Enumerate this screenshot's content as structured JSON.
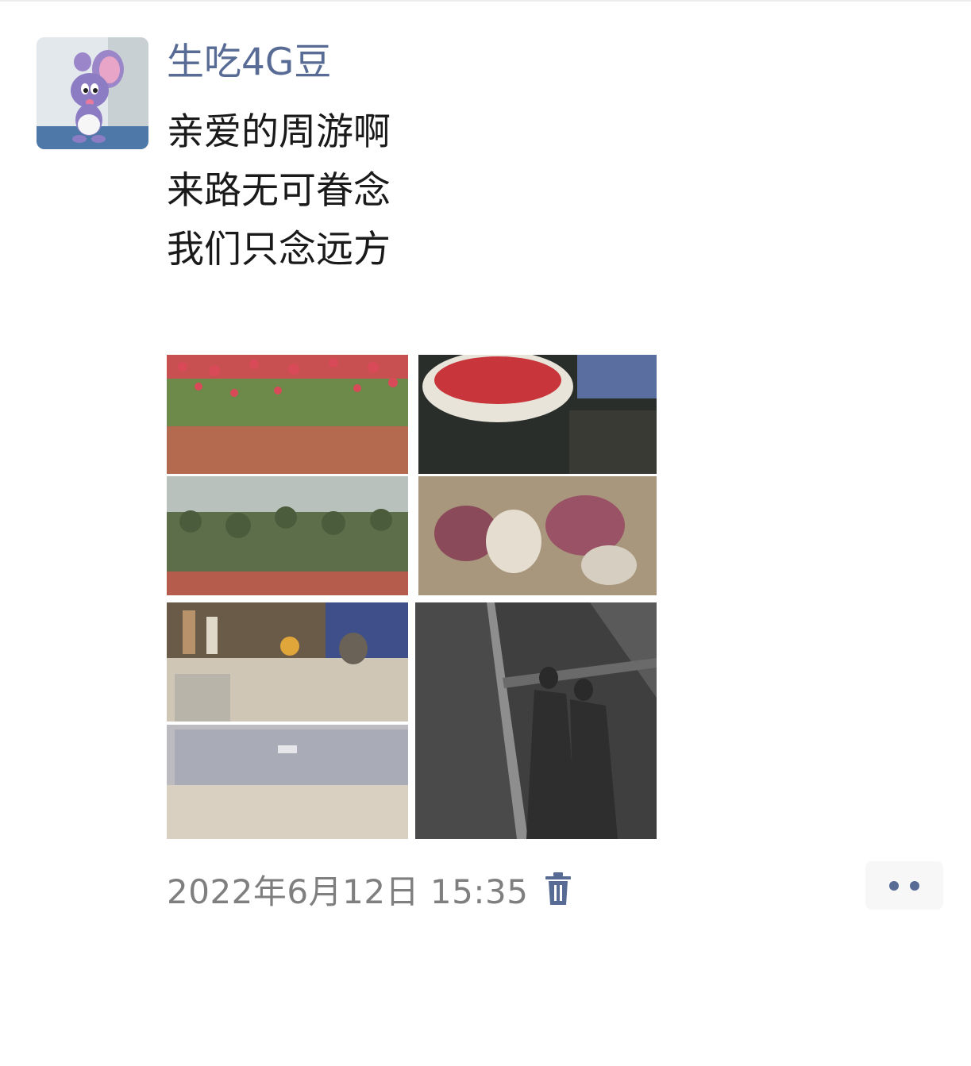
{
  "post": {
    "author_name": "生吃4G豆",
    "text_lines": [
      "亲爱的周游啊",
      "来路无可眷念",
      "我们只念远方"
    ],
    "timestamp": "2022年6月12日 15:35"
  },
  "photos": [
    {
      "id": "photo-roses-garden"
    },
    {
      "id": "photo-rose-bouquet"
    },
    {
      "id": "photo-desk-room"
    },
    {
      "id": "photo-shadow-road"
    }
  ],
  "icons": {
    "delete": "trash-icon",
    "more": "more-dots-icon"
  },
  "colors": {
    "link_name": "#576b95",
    "text": "#1a1a1a",
    "meta": "#7f7f7f",
    "more_button_bg": "#f7f7f7"
  }
}
